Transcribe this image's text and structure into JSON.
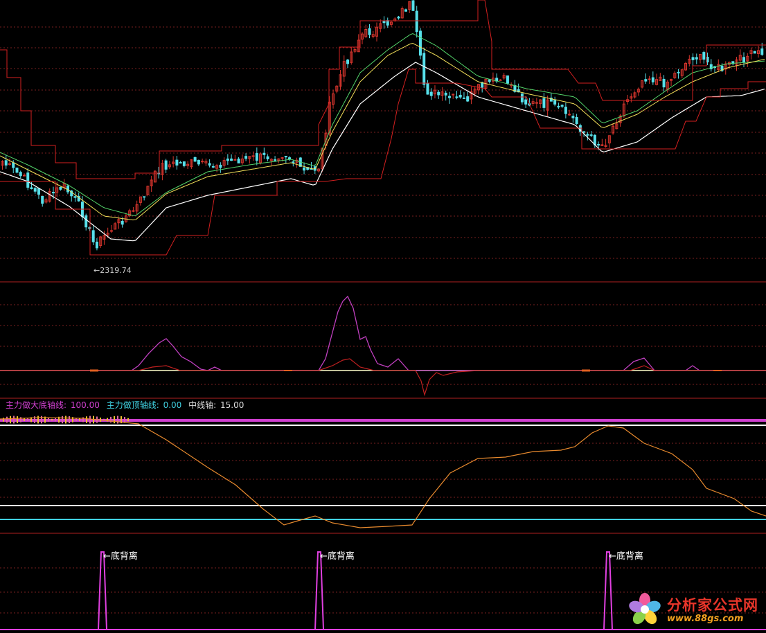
{
  "chart_data": [
    {
      "type": "candlestick",
      "panel": "main",
      "low_marker": {
        "label": "←2319.74",
        "value": 2319.74
      },
      "ylim": [
        2250,
        3150
      ],
      "candles_count": 210,
      "series": [
        {
          "name": "MA short",
          "color": "#ffffff"
        },
        {
          "name": "MA mid",
          "color": "#f4e15a"
        },
        {
          "name": "MA long",
          "color": "#53d36a"
        },
        {
          "name": "channel upper",
          "color": "#d42020"
        },
        {
          "name": "channel lower",
          "color": "#d42020"
        }
      ],
      "colors": {
        "up": "#d8352d",
        "down": "#57e0ea"
      }
    },
    {
      "type": "line",
      "panel": "oscillator",
      "series": [
        {
          "name": "magenta",
          "color": "#c040c0",
          "peaks": [
            {
              "x": 240,
              "value": 45
            },
            {
              "x": 500,
              "value": 105
            },
            {
              "x": 930,
              "value": 17
            }
          ]
        },
        {
          "name": "red",
          "color": "#c02020"
        },
        {
          "name": "baseline",
          "color": "#ffffcc",
          "value": 0
        }
      ]
    },
    {
      "type": "line",
      "panel": "axis",
      "legend": [
        {
          "text": "主力做大底轴线:",
          "color": "#d040d0"
        },
        {
          "text": "100.00",
          "color": "#d040d0"
        },
        {
          "text": "主力做顶轴线:",
          "color": "#40d0e0"
        },
        {
          "text": "0.00",
          "color": "#40d0e0"
        },
        {
          "text": "中线轴:",
          "color": "#dddddd"
        },
        {
          "text": "15.00",
          "color": "#dddddd"
        }
      ],
      "levels": {
        "bottom_axis": 100,
        "top_axis": 0,
        "mid_axis": 15
      },
      "series": [
        {
          "name": "orange curve",
          "color": "#e88a2e"
        }
      ]
    },
    {
      "type": "signal",
      "panel": "divergence",
      "signals": [
        {
          "x": 148,
          "label": "←底背离"
        },
        {
          "x": 461,
          "label": "←底背离"
        },
        {
          "x": 878,
          "label": "←底背离"
        }
      ],
      "color": "#e040e0"
    }
  ],
  "watermark": {
    "name": "分析家公式网",
    "url": "www.88gs.com"
  }
}
